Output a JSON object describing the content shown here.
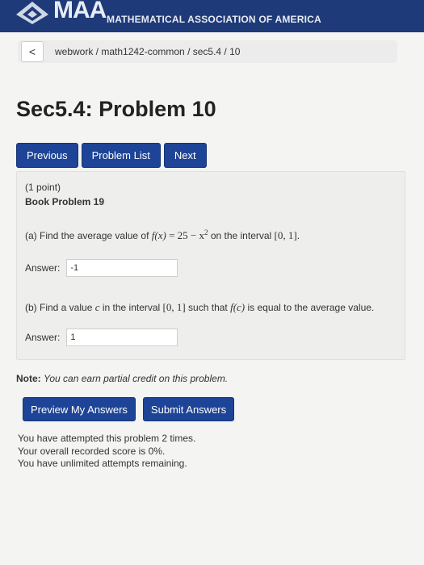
{
  "header": {
    "logo": "MAA",
    "org_name": "MATHEMATICAL ASSOCIATION OF AMERICA",
    "color": "#1f3a78"
  },
  "breadcrumb": {
    "back_icon": "chevron-left-icon",
    "back_label": "<",
    "path": "webwork / math1242-common / sec5.4 / 10"
  },
  "page_title": "Sec5.4: Problem 10",
  "nav": {
    "previous": "Previous",
    "problem_list": "Problem List",
    "next": "Next"
  },
  "problem": {
    "points": "(1 point)",
    "book_ref": "Book Problem 19",
    "part_a": {
      "prefix": "(a) Find the average value of ",
      "func": "f(x)",
      "expr": " = 25 − x",
      "sup": "2",
      "mid": " on the interval ",
      "interval": "[0, 1]",
      "suffix": "."
    },
    "answer_label": "Answer:",
    "answer_a": "-1",
    "part_b": {
      "prefix": "(b) Find a value ",
      "var": "c",
      "mid1": " in the interval ",
      "interval": "[0, 1]",
      "mid2": " such that ",
      "func": "f(c)",
      "suffix": " is equal to the average value."
    },
    "answer_b": "1"
  },
  "note": {
    "label": "Note:",
    "text": "You can earn partial credit on this problem."
  },
  "actions": {
    "preview": "Preview My Answers",
    "submit": "Submit Answers"
  },
  "status": {
    "line1": "You have attempted this problem 2 times.",
    "line2": "Your overall recorded score is 0%.",
    "line3": "You have unlimited attempts remaining."
  },
  "colors": {
    "button": "#1e4497",
    "page_bg": "#f4f4f2"
  }
}
